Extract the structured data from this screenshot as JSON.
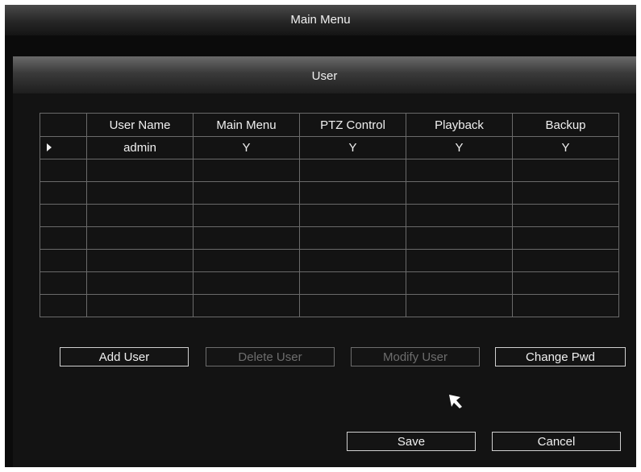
{
  "window": {
    "title": "Main Menu"
  },
  "panel": {
    "title": "User"
  },
  "table": {
    "headers": [
      "",
      "User Name",
      "Main Menu",
      "PTZ Control",
      "Playback",
      "Backup"
    ],
    "rows": [
      {
        "user_name": "admin",
        "main_menu": "Y",
        "ptz_control": "Y",
        "playback": "Y",
        "backup": "Y",
        "selected": true
      },
      {
        "user_name": "",
        "main_menu": "",
        "ptz_control": "",
        "playback": "",
        "backup": ""
      },
      {
        "user_name": "",
        "main_menu": "",
        "ptz_control": "",
        "playback": "",
        "backup": ""
      },
      {
        "user_name": "",
        "main_menu": "",
        "ptz_control": "",
        "playback": "",
        "backup": ""
      },
      {
        "user_name": "",
        "main_menu": "",
        "ptz_control": "",
        "playback": "",
        "backup": ""
      },
      {
        "user_name": "",
        "main_menu": "",
        "ptz_control": "",
        "playback": "",
        "backup": ""
      },
      {
        "user_name": "",
        "main_menu": "",
        "ptz_control": "",
        "playback": "",
        "backup": ""
      },
      {
        "user_name": "",
        "main_menu": "",
        "ptz_control": "",
        "playback": "",
        "backup": ""
      }
    ]
  },
  "actions": {
    "add_user": "Add User",
    "delete_user": "Delete User",
    "modify_user": "Modify User",
    "change_pwd": "Change Pwd"
  },
  "footer": {
    "save": "Save",
    "cancel": "Cancel"
  },
  "icons": {
    "row_selector": "selector-arrow-icon",
    "cursor": "mouse-pointer-icon"
  },
  "colors": {
    "background": "#0b0b0b",
    "text": "#f0f0f0",
    "disabled_text": "#6d6d6d",
    "grid_line": "#6a6a6a"
  }
}
